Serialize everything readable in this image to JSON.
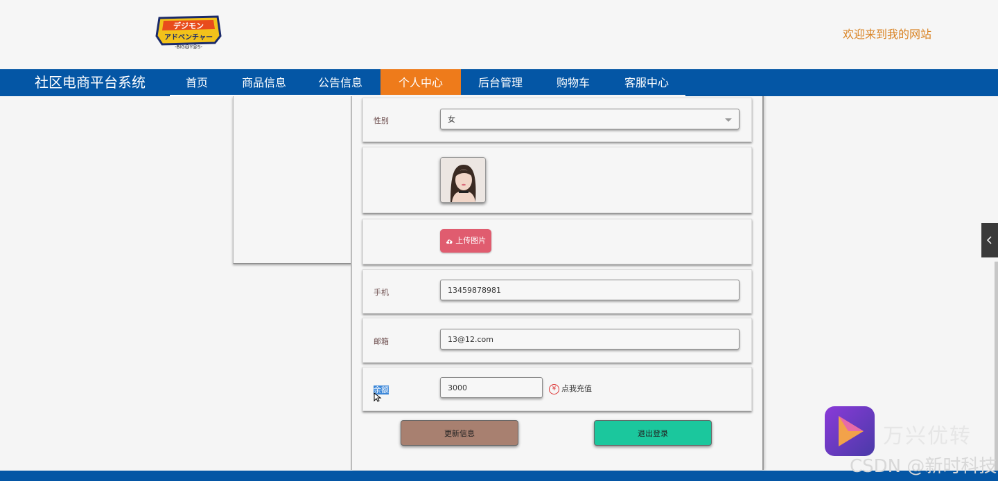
{
  "header": {
    "logo_text": "デジモンアドベンチャー -BIG@Y@S-",
    "welcome_text": "欢迎来到我的网站"
  },
  "nav": {
    "brand": "社区电商平台系统",
    "items": [
      {
        "label": "首页"
      },
      {
        "label": "商品信息"
      },
      {
        "label": "公告信息"
      },
      {
        "label": "个人中心",
        "active": true
      },
      {
        "label": "后台管理"
      },
      {
        "label": "购物车"
      },
      {
        "label": "客服中心"
      }
    ]
  },
  "form": {
    "gender_label": "性别",
    "gender_value": "女",
    "upload_label": "上传图片",
    "phone_label": "手机",
    "phone_value": "13459878981",
    "email_label": "邮箱",
    "email_value": "13@12.com",
    "balance_label": "余额",
    "balance_value": "3000",
    "recharge_label": "点我充值",
    "yen_symbol": "¥",
    "update_button": "更新信息",
    "logout_button": "退出登录"
  },
  "watermark": {
    "brand": "万兴优转",
    "csdn": "CSDN @新时科技"
  },
  "colors": {
    "nav_bg": "#0456a5",
    "nav_active": "#ee7b1b",
    "welcome": "#d98323",
    "upload_btn": "#e05c6f",
    "update_btn": "#a88070",
    "logout_btn": "#1bc79d"
  },
  "icons": {
    "upload": "cloud-upload-icon",
    "recharge": "yen-circle-icon",
    "side_toggle": "chevron-left-icon"
  }
}
